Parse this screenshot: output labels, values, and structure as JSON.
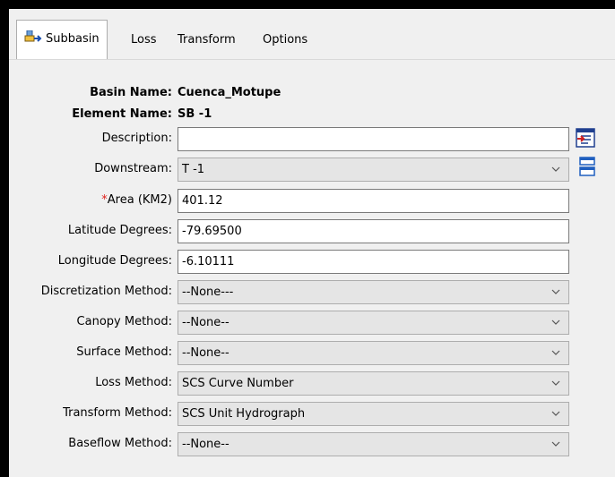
{
  "tabs": [
    {
      "label": "Subbasin",
      "active": true
    },
    {
      "label": "Loss"
    },
    {
      "label": "Transform"
    },
    {
      "label": "Options"
    }
  ],
  "header": {
    "basin_label": "Basin Name:",
    "basin_value": "Cuenca_Motupe",
    "element_label": "Element Name:",
    "element_value": "SB -1"
  },
  "fields": {
    "description": {
      "label": "Description:",
      "value": ""
    },
    "downstream": {
      "label": "Downstream:",
      "value": "T -1"
    },
    "area": {
      "required_mark": "*",
      "label": "Area (KM2)",
      "value": "401.12"
    },
    "latitude": {
      "label": "Latitude Degrees:",
      "value": "-79.69500"
    },
    "longitude": {
      "label": "Longitude Degrees:",
      "value": "-6.10111"
    },
    "discretization": {
      "label": "Discretization Method:",
      "value": "--None---"
    },
    "canopy": {
      "label": "Canopy Method:",
      "value": "--None--"
    },
    "surface": {
      "label": "Surface Method:",
      "value": "--None--"
    },
    "loss": {
      "label": "Loss Method:",
      "value": "SCS Curve Number"
    },
    "transform": {
      "label": "Transform Method:",
      "value": "SCS Unit Hydrograph"
    },
    "baseflow": {
      "label": "Baseflow Method:",
      "value": "--None--"
    }
  },
  "colors": {
    "required": "#e0201b",
    "panel": "#f0f0f0",
    "combo": "#e5e5e5"
  },
  "icons": {
    "tab": "subbasin-icon",
    "description": "edit-description-icon",
    "downstream": "downstream-element-icon"
  }
}
